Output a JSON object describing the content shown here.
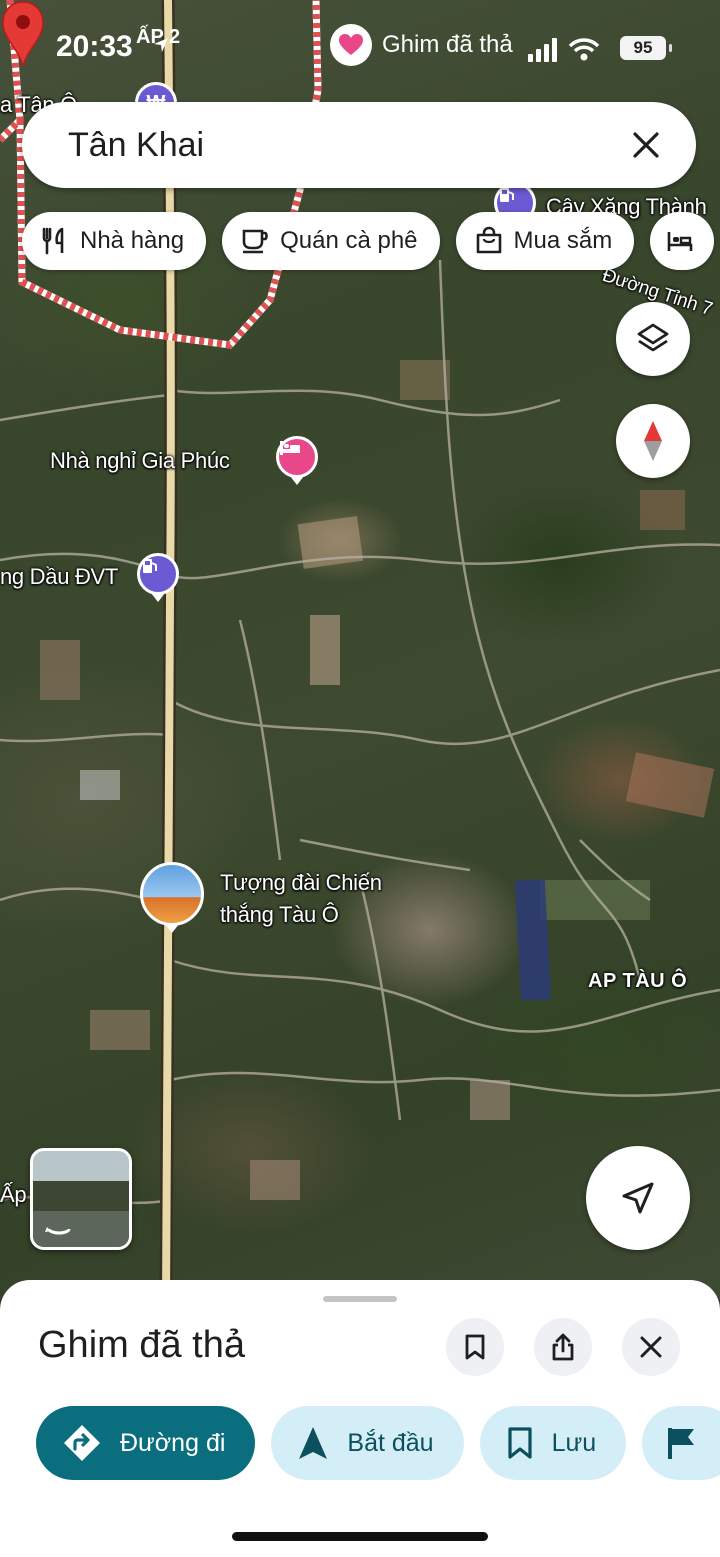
{
  "status_bar": {
    "time": "20:33",
    "location_label": "ẤP 2",
    "pin_label": "Ghim đã thả",
    "battery": "95"
  },
  "search": {
    "query": "Tân Khai"
  },
  "chips": [
    {
      "label": "Nhà hàng",
      "icon": "restaurant-icon"
    },
    {
      "label": "Quán cà phê",
      "icon": "coffee-icon"
    },
    {
      "label": "Mua sắm",
      "icon": "shopping-bag-icon"
    },
    {
      "label": "",
      "icon": "hotel-icon"
    }
  ],
  "map": {
    "labels": {
      "tan_o": "a Tân Ô",
      "gas_thanh": "Cây Xăng Thành",
      "road": "Đường Tỉnh 7",
      "motel": "Nhà nghỉ Gia Phúc",
      "gas_dvt": "ng Dầu ĐVT",
      "monument_line1": "Tượng đài Chiến",
      "monument_line2": "thắng Tàu Ô",
      "hamlet": "AP TÀU Ô",
      "ap": "Ấp"
    },
    "colors": {
      "dropped_pin": "#e53935",
      "boundary": "#e05050",
      "poi_purple": "#6b5bd3",
      "poi_pink": "#e8488a",
      "primary_action": "#0b6e7e"
    }
  },
  "sheet": {
    "title": "Ghim đã thả",
    "actions": [
      {
        "label": "Đường đi",
        "icon": "directions-icon"
      },
      {
        "label": "Bắt đầu",
        "icon": "navigation-arrow-icon"
      },
      {
        "label": "Lưu",
        "icon": "bookmark-icon"
      },
      {
        "label": "",
        "icon": "flag-icon"
      }
    ]
  }
}
